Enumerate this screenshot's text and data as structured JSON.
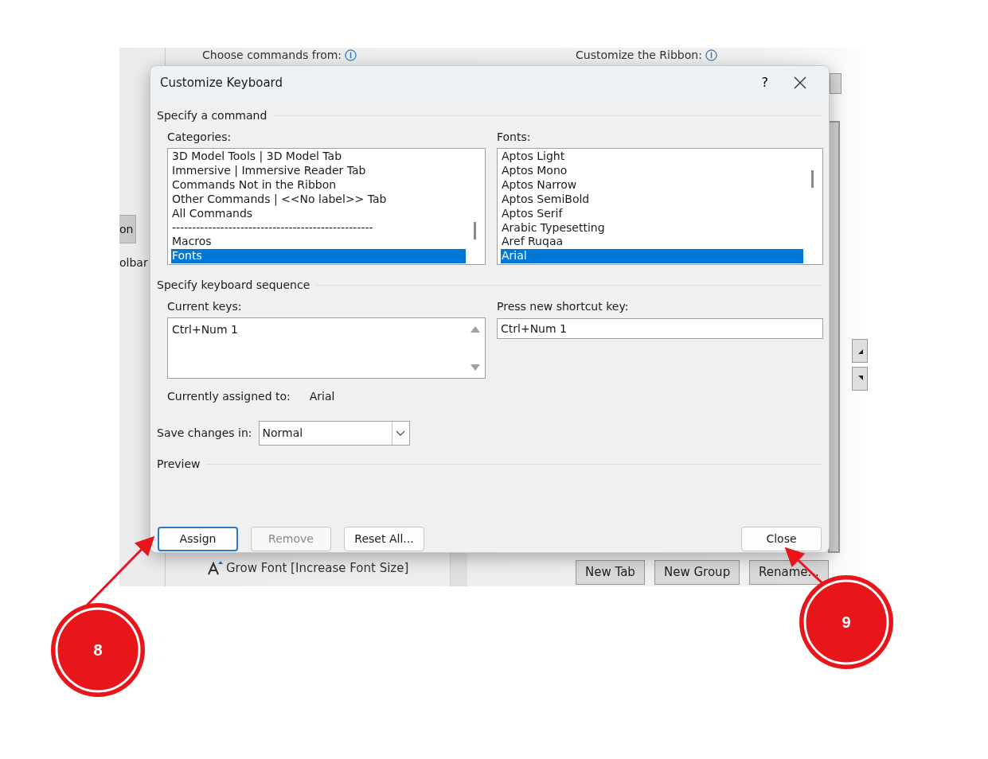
{
  "background": {
    "labels": [
      {
        "text": "Choose commands from:"
      },
      {
        "text": "Customize the Ribbon:"
      }
    ],
    "side_tabs": [
      {
        "text": "on",
        "selected": true
      },
      {
        "text": "olbar",
        "selected": false
      }
    ],
    "command_item": "Grow Font [Increase Font Size]",
    "buttons": [
      "New Tab",
      "New Group",
      "Rename..."
    ]
  },
  "dialog": {
    "title": "Customize Keyboard",
    "help": "?",
    "command_heading": "Specify a command",
    "categories": {
      "label": "Categories:",
      "items": [
        {
          "text": "3D Model Tools | 3D Model Tab",
          "selected": false
        },
        {
          "text": "Immersive | Immersive Reader Tab",
          "selected": false
        },
        {
          "text": "Commands Not in the Ribbon",
          "selected": false
        },
        {
          "text": "Other Commands | <<No label>> Tab",
          "selected": false
        },
        {
          "text": "All Commands",
          "selected": false
        },
        {
          "text": "--------------------------------------------------",
          "selected": false
        },
        {
          "text": "Macros",
          "selected": false
        },
        {
          "text": "Fonts",
          "selected": true
        }
      ]
    },
    "fonts": {
      "label": "Fonts:",
      "items": [
        {
          "text": "Aptos Light",
          "selected": false
        },
        {
          "text": "Aptos Mono",
          "selected": false
        },
        {
          "text": "Aptos Narrow",
          "selected": false
        },
        {
          "text": "Aptos SemiBold",
          "selected": false
        },
        {
          "text": "Aptos Serif",
          "selected": false
        },
        {
          "text": "Arabic Typesetting",
          "selected": false
        },
        {
          "text": "Aref Ruqaa",
          "selected": false
        },
        {
          "text": "Arial",
          "selected": true
        }
      ]
    },
    "sequence_heading": "Specify keyboard sequence",
    "current_keys": {
      "label": "Current keys:",
      "items": [
        "Ctrl+Num 1"
      ]
    },
    "new_shortcut": {
      "label": "Press new shortcut key:",
      "value": "Ctrl+Num 1"
    },
    "assigned": {
      "label": "Currently assigned to:",
      "value": "Arial"
    },
    "save_in": {
      "label": "Save changes in:",
      "value": "Normal"
    },
    "preview_heading": "Preview",
    "buttons": [
      {
        "label": "Assign",
        "default": true,
        "disabled": false
      },
      {
        "label": "Remove",
        "default": false,
        "disabled": true
      },
      {
        "label": "Reset All...",
        "default": false,
        "disabled": false
      },
      {
        "label": "Close",
        "default": false,
        "disabled": false
      }
    ]
  },
  "annotations": [
    {
      "number": "8"
    },
    {
      "number": "9"
    }
  ]
}
